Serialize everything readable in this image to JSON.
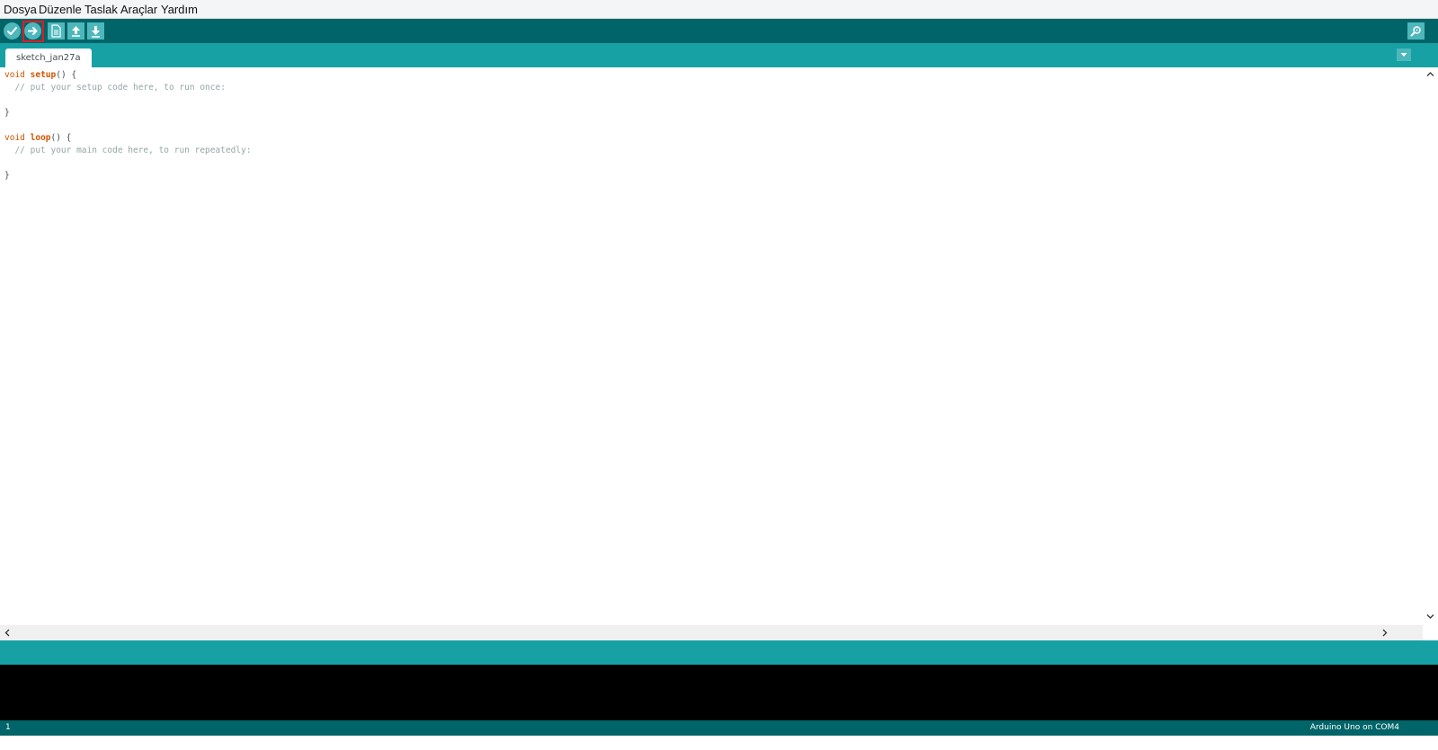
{
  "menu": {
    "items": [
      "Dosya",
      "Düzenle",
      "Taslak",
      "Araçlar",
      "Yardım"
    ]
  },
  "toolbar": {
    "buttons": [
      "verify-icon",
      "upload-icon",
      "new-icon",
      "open-icon",
      "save-icon"
    ],
    "right_button": "serial-monitor-icon",
    "highlighted": "upload-button"
  },
  "tabs": {
    "active": "sketch_jan27a"
  },
  "code": {
    "kw_void": "void",
    "fn_setup": "setup",
    "fn_loop": "loop",
    "paren_brace": "() {",
    "comment_setup": "  // put your setup code here, to run once:",
    "comment_loop": "  // put your main code here, to run repeatedly:",
    "close_brace": "}"
  },
  "status": {
    "line_number": "1",
    "board": "Arduino Uno on COM4"
  },
  "colors": {
    "toolbar": "#006468",
    "tabbar": "#17a1a5",
    "button": "#4db7bb",
    "keyword": "#d35400",
    "comment": "#95a5a6",
    "highlight": "#e21b23"
  }
}
